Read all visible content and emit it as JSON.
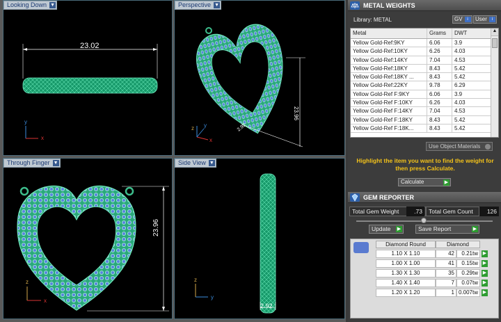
{
  "viewports": [
    {
      "label": "Looking Down",
      "dimension": "23.02"
    },
    {
      "label": "Perspective",
      "dimension_a": "23.96",
      "dimension_b": "2.92"
    },
    {
      "label": "Through Finger",
      "dimension": "23.96"
    },
    {
      "label": "Side View",
      "dimension": "2.92"
    }
  ],
  "axes": {
    "x": "x",
    "y": "y",
    "z": "z"
  },
  "metal_weights": {
    "title": "METAL WEIGHTS",
    "library_label": "Library: METAL",
    "btn_gv": "GV",
    "btn_user": "User",
    "columns": [
      "Metal",
      "Grams",
      "DWT"
    ],
    "rows": [
      [
        "Yellow Gold-Ref:9KY",
        "6.06",
        "3.9"
      ],
      [
        "Yellow Gold-Ref:10KY",
        "6.26",
        "4.03"
      ],
      [
        "Yellow Gold-Ref:14KY",
        "7.04",
        "4.53"
      ],
      [
        "Yellow Gold-Ref:18KY",
        "8.43",
        "5.42"
      ],
      [
        "Yellow Gold-Ref:18KY ...",
        "8.43",
        "5.42"
      ],
      [
        "Yellow Gold-Ref:22KY",
        "9.78",
        "6.29"
      ],
      [
        "Yellow Gold-Ref F:9KY",
        "6.06",
        "3.9"
      ],
      [
        "Yellow Gold-Ref F:10KY",
        "6.26",
        "4.03"
      ],
      [
        "Yellow Gold-Ref F:14KY",
        "7.04",
        "4.53"
      ],
      [
        "Yellow Gold-Ref F:18KY",
        "8.43",
        "5.42"
      ],
      [
        "Yellow Gold-Ref F:18K...",
        "8.43",
        "5.42"
      ]
    ],
    "use_object_materials": "Use Object Materials",
    "hint": "Highlight the item you want to find the weight for then press Calculate.",
    "calculate": "Calculate"
  },
  "gem_reporter": {
    "title": "GEM REPORTER",
    "total_gem_weight_label": "Total Gem Weight",
    "total_gem_weight": ".73",
    "total_gem_count_label": "Total Gem Count",
    "total_gem_count": "126",
    "update": "Update",
    "save_report": "Save Report",
    "col_round": "Diamond Round",
    "col_diamond": "Diamond",
    "rows": [
      [
        "1.10 X 1.10",
        "42",
        "0.21tw"
      ],
      [
        "1.00 X 1.00",
        "41",
        "0.15tw"
      ],
      [
        "1.30 X 1.30",
        "35",
        "0.29tw"
      ],
      [
        "1.40 X 1.40",
        "7",
        "0.07tw"
      ],
      [
        "1.20 X 1.20",
        "1",
        "0.007tw"
      ]
    ]
  },
  "colors": {
    "accent": "#f3c21a",
    "mesh": "#1fae7a",
    "gems": "#4f7fd8",
    "go": "#2e9c31"
  }
}
